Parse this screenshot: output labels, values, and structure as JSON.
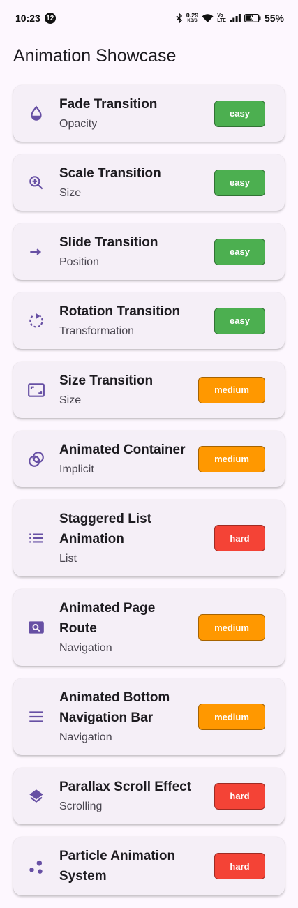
{
  "status_bar": {
    "time": "10:23",
    "notification_count": "12",
    "net_speed_value": "0.29",
    "net_speed_unit": "KB/S",
    "volte_top": "Vo",
    "volte_bottom": "LTE",
    "battery_percent": "55%"
  },
  "app_bar": {
    "title": "Animation Showcase"
  },
  "colors": {
    "easy": "#4caf50",
    "medium": "#ff9800",
    "hard": "#f44336",
    "icon": "#6750a4"
  },
  "animations": [
    {
      "title": "Fade Transition",
      "subtitle": "Opacity",
      "difficulty": "easy",
      "icon": "opacity-icon"
    },
    {
      "title": "Scale Transition",
      "subtitle": "Size",
      "difficulty": "easy",
      "icon": "zoom-in-icon"
    },
    {
      "title": "Slide Transition",
      "subtitle": "Position",
      "difficulty": "easy",
      "icon": "arrow-right-icon"
    },
    {
      "title": "Rotation Transition",
      "subtitle": "Transformation",
      "difficulty": "easy",
      "icon": "rotate-icon"
    },
    {
      "title": "Size Transition",
      "subtitle": "Size",
      "difficulty": "medium",
      "icon": "aspect-ratio-icon"
    },
    {
      "title": "Animated Container",
      "subtitle": "Implicit",
      "difficulty": "medium",
      "icon": "bubbles-icon"
    },
    {
      "title": "Staggered List Animation",
      "subtitle": "List",
      "difficulty": "hard",
      "icon": "list-icon"
    },
    {
      "title": "Animated Page Route",
      "subtitle": "Navigation",
      "difficulty": "medium",
      "icon": "image-search-icon"
    },
    {
      "title": "Animated Bottom Navigation Bar",
      "subtitle": "Navigation",
      "difficulty": "medium",
      "icon": "menu-icon"
    },
    {
      "title": "Parallax Scroll Effect",
      "subtitle": "Scrolling",
      "difficulty": "hard",
      "icon": "layers-icon"
    },
    {
      "title": "Particle Animation System",
      "subtitle": "",
      "difficulty": "hard",
      "icon": "scatter-icon"
    }
  ]
}
